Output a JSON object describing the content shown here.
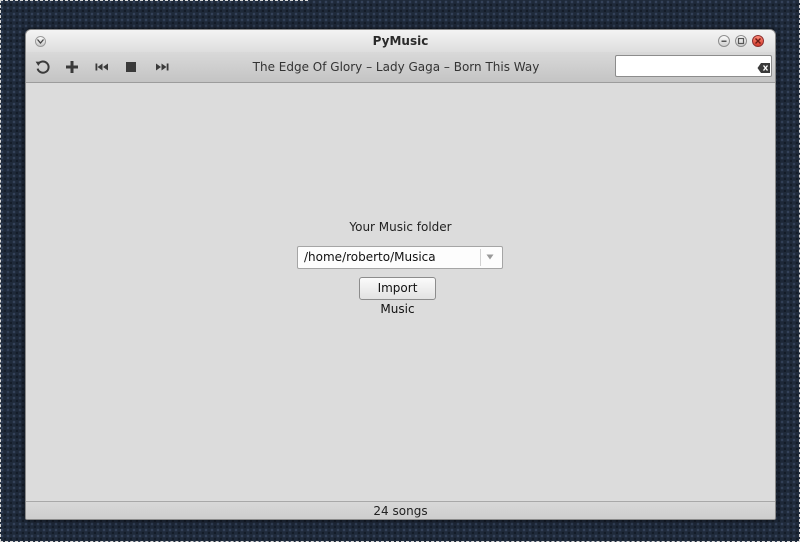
{
  "window": {
    "title": "PyMusic"
  },
  "toolbar": {
    "buttons": [
      {
        "icon": "refresh-icon"
      },
      {
        "icon": "add-icon"
      },
      {
        "icon": "previous-track-icon"
      },
      {
        "icon": "stop-icon"
      },
      {
        "icon": "next-track-icon"
      }
    ],
    "now_playing": "The Edge Of Glory – Lady Gaga – Born This Way",
    "search": {
      "value": "",
      "placeholder": "",
      "clear_icon": "clear-text-icon"
    }
  },
  "main": {
    "folder_label": "Your Music folder",
    "folder_value": "/home/roberto/Musica",
    "import_button": "Import Music"
  },
  "statusbar": {
    "text": "24 songs"
  },
  "colors": {
    "window_bg": "#dcdcdc",
    "close_button": "#d33a2a",
    "desktop_bg": "#1f2a3a"
  }
}
